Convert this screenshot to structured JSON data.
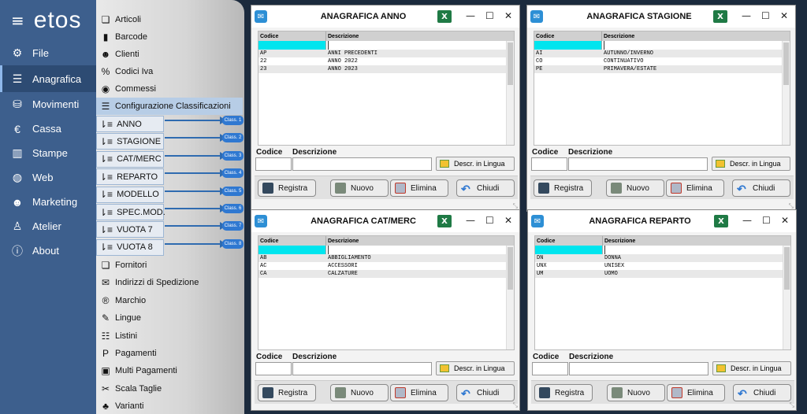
{
  "app": {
    "logo": "etos"
  },
  "nav": [
    {
      "label": "File",
      "icon": "⚙"
    },
    {
      "label": "Anagrafica",
      "icon": "☰"
    },
    {
      "label": "Movimenti",
      "icon": "⛁"
    },
    {
      "label": "Cassa",
      "icon": "€"
    },
    {
      "label": "Stampe",
      "icon": "▥"
    },
    {
      "label": "Web",
      "icon": "◍"
    },
    {
      "label": "Marketing",
      "icon": "☻"
    },
    {
      "label": "Atelier",
      "icon": "♙"
    },
    {
      "label": "About",
      "icon": "ⓘ"
    }
  ],
  "submenu_top": [
    {
      "label": "Articoli",
      "icon": "❏"
    },
    {
      "label": "Barcode",
      "icon": "▮"
    },
    {
      "label": "Clienti",
      "icon": "☻"
    },
    {
      "label": "Codici Iva",
      "icon": "%"
    },
    {
      "label": "Commessi",
      "icon": "◉"
    },
    {
      "label": "Configurazione Classificazioni",
      "icon": "☰"
    }
  ],
  "classifications": [
    {
      "label": "ANNO",
      "badge": "Class. 1"
    },
    {
      "label": "STAGIONE",
      "badge": "Class. 2"
    },
    {
      "label": "CAT/MERC",
      "badge": "Class. 3"
    },
    {
      "label": "REPARTO",
      "badge": "Class. 4"
    },
    {
      "label": "MODELLO",
      "badge": "Class. 5"
    },
    {
      "label": "SPEC.MOD.",
      "badge": "Class. 6"
    },
    {
      "label": "VUOTA 7",
      "badge": "Class. 7"
    },
    {
      "label": "VUOTA 8",
      "badge": "Class. 8"
    }
  ],
  "submenu_bottom": [
    {
      "label": "Fornitori",
      "icon": "❏"
    },
    {
      "label": "Indirizzi di Spedizione",
      "icon": "✉"
    },
    {
      "label": "Marchio",
      "icon": "®"
    },
    {
      "label": "Lingue",
      "icon": "✎"
    },
    {
      "label": "Listini",
      "icon": "☷"
    },
    {
      "label": "Pagamenti",
      "icon": "P"
    },
    {
      "label": "Multi Pagamenti",
      "icon": "▣"
    },
    {
      "label": "Scala Taglie",
      "icon": "✂"
    },
    {
      "label": "Varianti",
      "icon": "♣"
    }
  ],
  "window_common": {
    "col_code": "Codice",
    "col_desc": "Descrizione",
    "lbl_code": "Codice",
    "lbl_desc": "Descrizione",
    "btn_lingua": "Descr. in Lingua",
    "btn_save": "Registra",
    "btn_new": "Nuovo",
    "btn_delete": "Elimina",
    "btn_close": "Chiudi"
  },
  "windows": [
    {
      "title": "ANAGRAFICA ANNO",
      "rows": [
        [
          "AP",
          "ANNI PRECEDENTI"
        ],
        [
          "22",
          "ANNO 2022"
        ],
        [
          "23",
          "ANNO 2023"
        ]
      ]
    },
    {
      "title": "ANAGRAFICA STAGIONE",
      "rows": [
        [
          "AI",
          "AUTUNNO/INVERNO"
        ],
        [
          "CO",
          "CONTINUATIVO"
        ],
        [
          "PE",
          "PRIMAVERA/ESTATE"
        ]
      ]
    },
    {
      "title": "ANAGRAFICA CAT/MERC",
      "rows": [
        [
          "AB",
          "ABBIGLIAMENTO"
        ],
        [
          "AC",
          "ACCESSORI"
        ],
        [
          "CA",
          "CALZATURE"
        ]
      ]
    },
    {
      "title": "ANAGRAFICA REPARTO",
      "rows": [
        [
          "DN",
          "DONNA"
        ],
        [
          "UNX",
          "UNISEX"
        ],
        [
          "UM",
          "UOMO"
        ]
      ]
    }
  ]
}
